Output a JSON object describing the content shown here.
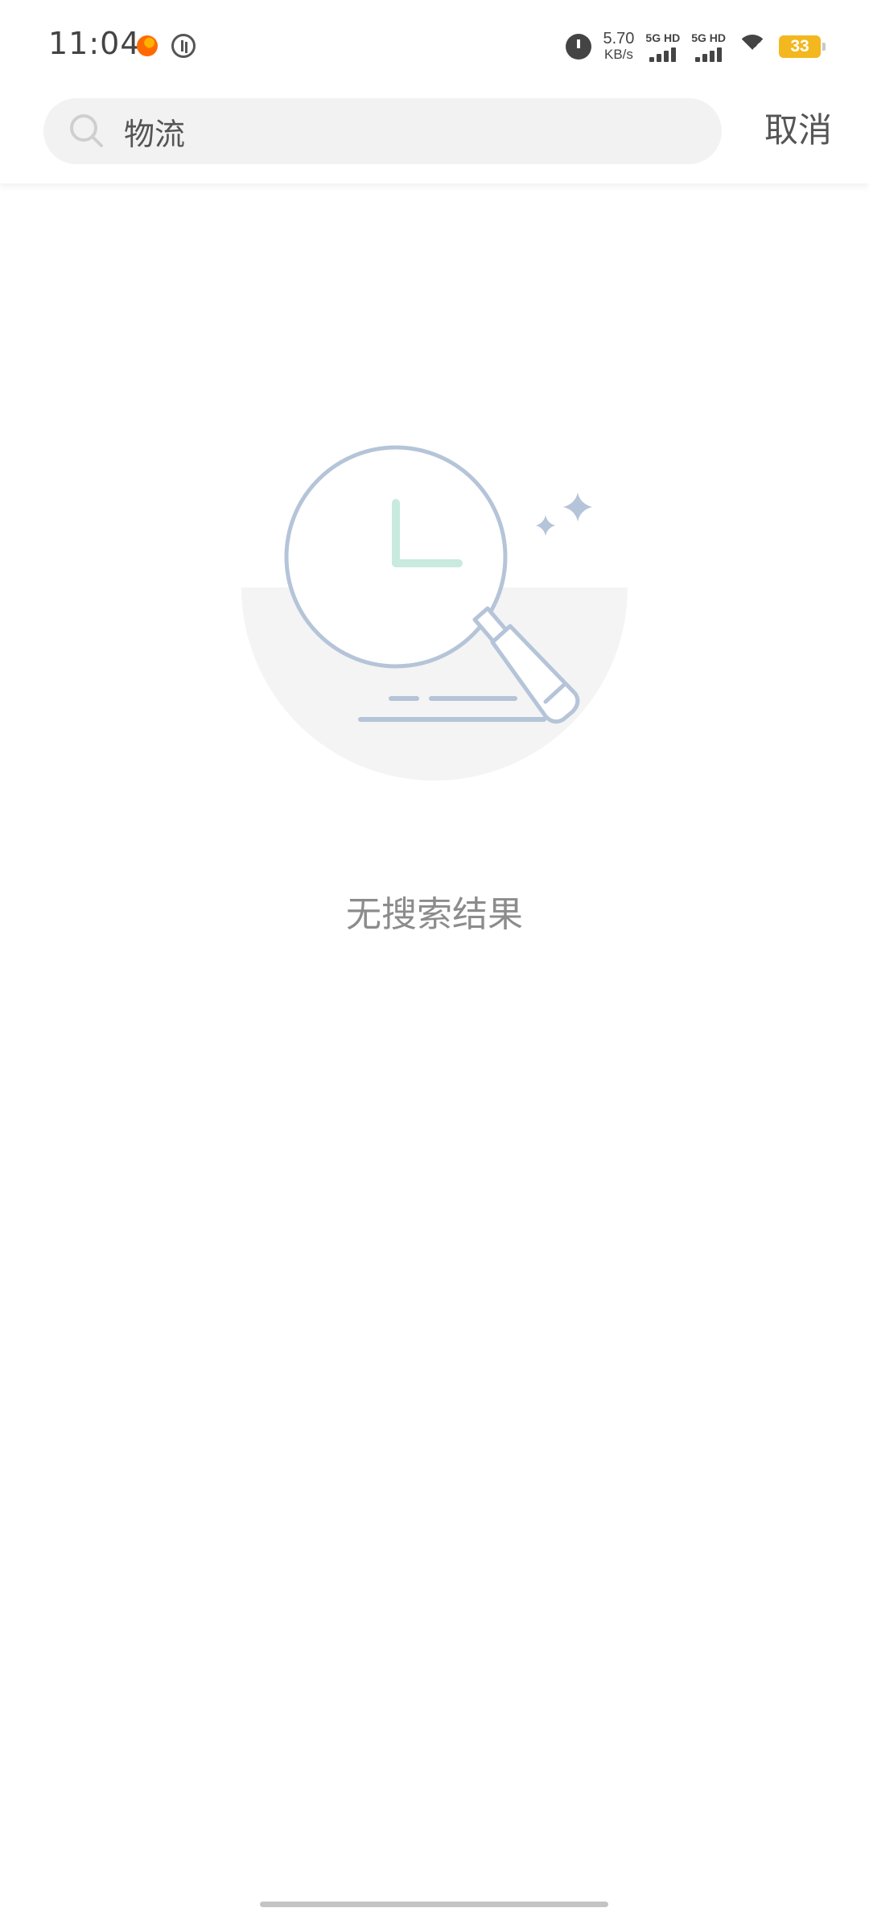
{
  "status_bar": {
    "time": "11:04",
    "net_speed_value": "5.70",
    "net_speed_unit": "KB/s",
    "sim1_label": "5G HD",
    "sim2_label": "5G HD",
    "battery_level": "33",
    "battery_color": "#f3b71f"
  },
  "search": {
    "value": "物流",
    "cancel_label": "取消"
  },
  "empty_state": {
    "message": "无搜索结果"
  },
  "colors": {
    "illustration_stroke": "#b5c4d8",
    "illustration_clock_hand": "#c8eadf",
    "illustration_bg": "#f4f4f4"
  }
}
